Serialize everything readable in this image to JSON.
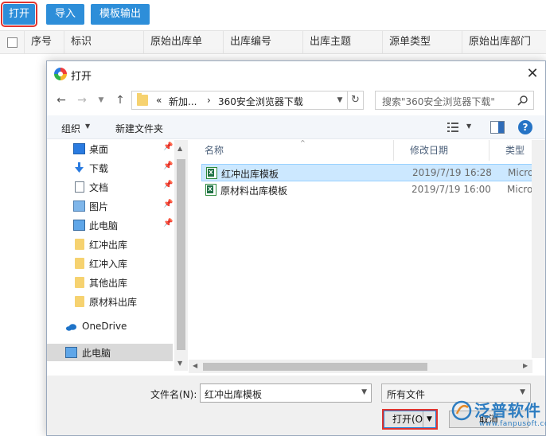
{
  "toolbar": {
    "open_label": "打开",
    "import_label": "导入",
    "template_export_label": "模板输出"
  },
  "grid": {
    "columns": [
      "序号",
      "标识",
      "原始出库单",
      "出库编号",
      "出库主题",
      "源单类型",
      "原始出库部门"
    ]
  },
  "dialog": {
    "title": "打开",
    "close_glyph": "✕",
    "address": {
      "chevron": "«",
      "segment_1": "新加...",
      "separator": "›",
      "segment_2": "360安全浏览器下载"
    },
    "search_placeholder": "搜索\"360安全浏览器下载\"",
    "commands": {
      "organize": "组织",
      "new_folder": "新建文件夹"
    },
    "nav_items": [
      {
        "label": "桌面",
        "icon": "desktop-icon",
        "pinned": true
      },
      {
        "label": "下载",
        "icon": "download-icon",
        "pinned": true
      },
      {
        "label": "文档",
        "icon": "document-icon",
        "pinned": true
      },
      {
        "label": "图片",
        "icon": "picture-icon",
        "pinned": true
      },
      {
        "label": "此电脑",
        "icon": "computer-icon",
        "pinned": true
      },
      {
        "label": "红冲出库",
        "icon": "folder-icon",
        "pinned": false
      },
      {
        "label": "红冲入库",
        "icon": "folder-icon",
        "pinned": false
      },
      {
        "label": "其他出库",
        "icon": "folder-icon",
        "pinned": false
      },
      {
        "label": "原材料出库",
        "icon": "folder-icon",
        "pinned": false
      },
      {
        "label": "OneDrive",
        "icon": "cloud-icon",
        "pinned": false
      },
      {
        "label": "此电脑",
        "icon": "computer-icon",
        "pinned": false,
        "selected": true
      }
    ],
    "columns": {
      "name": "名称",
      "date": "修改日期",
      "type": "类型"
    },
    "files": [
      {
        "name": "红冲出库模板",
        "date": "2019/7/19 16:28",
        "type": "Microso",
        "selected": true
      },
      {
        "name": "原材料出库模板",
        "date": "2019/7/19 16:00",
        "type": "Microso",
        "selected": false
      }
    ],
    "filename_label": "文件名(N):",
    "filename_value": "红冲出库模板",
    "filetype_value": "所有文件",
    "open_button": "打开(O)",
    "cancel_button": "取消"
  },
  "watermark": {
    "brand": "泛普软件",
    "url": "www.fanpusoft.com"
  },
  "colors": {
    "toolbar_button": "#2d8ed9",
    "highlight_outline": "#e0342f",
    "selection": "#cce8ff"
  }
}
